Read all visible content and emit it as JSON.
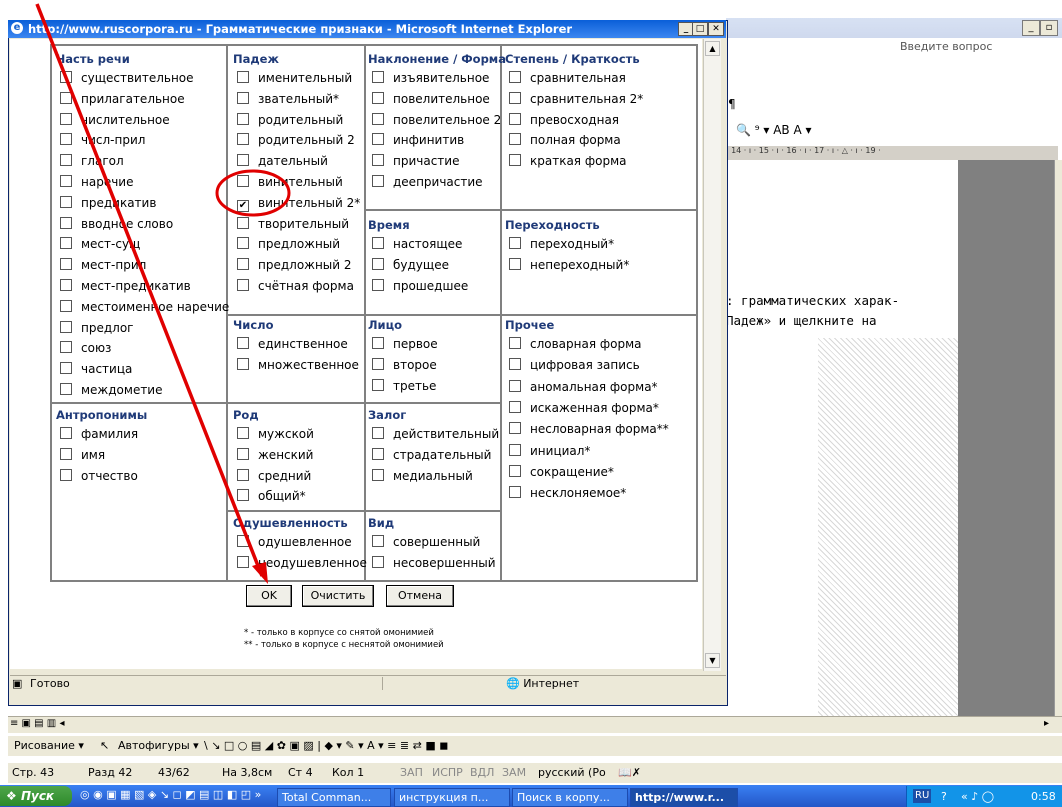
{
  "word": {
    "ask_placeholder": "Введите вопрос",
    "ruler_text": "· 14 · ı · 15 · ı · 16 · ı · 17 · ı · △ · ı · 19 ·",
    "body_line1": ": грамматических харак-",
    "body_line2": "Падеж» и щелкните на",
    "menu_draw": "Рисование ▾",
    "menu_autoshapes": "Автофигуры ▾",
    "status": {
      "page": "Стр. 43",
      "section": "Разд 42",
      "pages": "43/62",
      "at": "На 3,8см",
      "line": "Ст 4",
      "col": "Кол 1",
      "rec": "ЗАП",
      "trk": "ИСПР",
      "ext": "ВДЛ",
      "ovr": "ЗАМ",
      "lang": "русский (Ро"
    }
  },
  "ie": {
    "title": "http://www.ruscorpora.ru - Грамматические признаки - Microsoft Internet Explorer",
    "status_left": "Готово",
    "status_zone": "Интернет"
  },
  "form": {
    "pos": {
      "header": "Часть речи",
      "items": [
        "существительное",
        "прилагательное",
        "числительное",
        "числ-прил",
        "глагол",
        "наречие",
        "предикатив",
        "вводное слово",
        "мест-сущ",
        "мест-прил",
        "мест-предикатив",
        "местоименное наречие",
        "предлог",
        "союз",
        "частица",
        "междометие"
      ]
    },
    "case": {
      "header": "Падеж",
      "items": [
        "именительный",
        "звательный*",
        "родительный",
        "родительный 2",
        "дательный",
        "винительный",
        "винительный 2*",
        "творительный",
        "предложный",
        "предложный 2",
        "счётная форма"
      ],
      "checked_index": 6
    },
    "mood": {
      "header": "Наклонение / Форма",
      "items": [
        "изъявительное",
        "повелительное",
        "повелительное 2",
        "инфинитив",
        "причастие",
        "деепричастие"
      ]
    },
    "degree": {
      "header": "Степень / Краткость",
      "items": [
        "сравнительная",
        "сравнительная 2*",
        "превосходная",
        "полная форма",
        "краткая форма"
      ]
    },
    "tense": {
      "header": "Время",
      "items": [
        "настоящее",
        "будущее",
        "прошедшее"
      ]
    },
    "transit": {
      "header": "Переходность",
      "items": [
        "переходный*",
        "непереходный*"
      ]
    },
    "number": {
      "header": "Число",
      "items": [
        "единственное",
        "множественное"
      ]
    },
    "person": {
      "header": "Лицо",
      "items": [
        "первое",
        "второе",
        "третье"
      ]
    },
    "other": {
      "header": "Прочее",
      "items": [
        "словарная форма",
        "цифровая запись",
        "аномальная форма*",
        "искаженная форма*",
        "несловарная форма**",
        "инициал*",
        "сокращение*",
        "несклоняемое*"
      ]
    },
    "anthro": {
      "header": "Антропонимы",
      "items": [
        "фамилия",
        "имя",
        "отчество"
      ]
    },
    "gender": {
      "header": "Род",
      "items": [
        "мужской",
        "женский",
        "средний",
        "общий*"
      ]
    },
    "voice": {
      "header": "Залог",
      "items": [
        "действительный",
        "страдательный",
        "медиальный"
      ]
    },
    "anim": {
      "header": "Одушевленность",
      "items": [
        "одушевленное",
        "неодушевленное"
      ]
    },
    "aspect": {
      "header": "Вид",
      "items": [
        "совершенный",
        "несовершенный"
      ]
    },
    "buttons": {
      "ok": "OK",
      "clear": "Очистить",
      "cancel": "Отмена"
    },
    "note1": "* - только в корпусе со снятой омонимией",
    "note2": "** - только в корпусе с неснятой омонимией"
  },
  "taskbar": {
    "start": "Пуск",
    "tasks": [
      "Total Comman...",
      "инструкция п...",
      "Поиск в корпу...",
      "http://www.r..."
    ],
    "lang": "RU",
    "clock": "0:58"
  },
  "annotation_color": "#e00000"
}
